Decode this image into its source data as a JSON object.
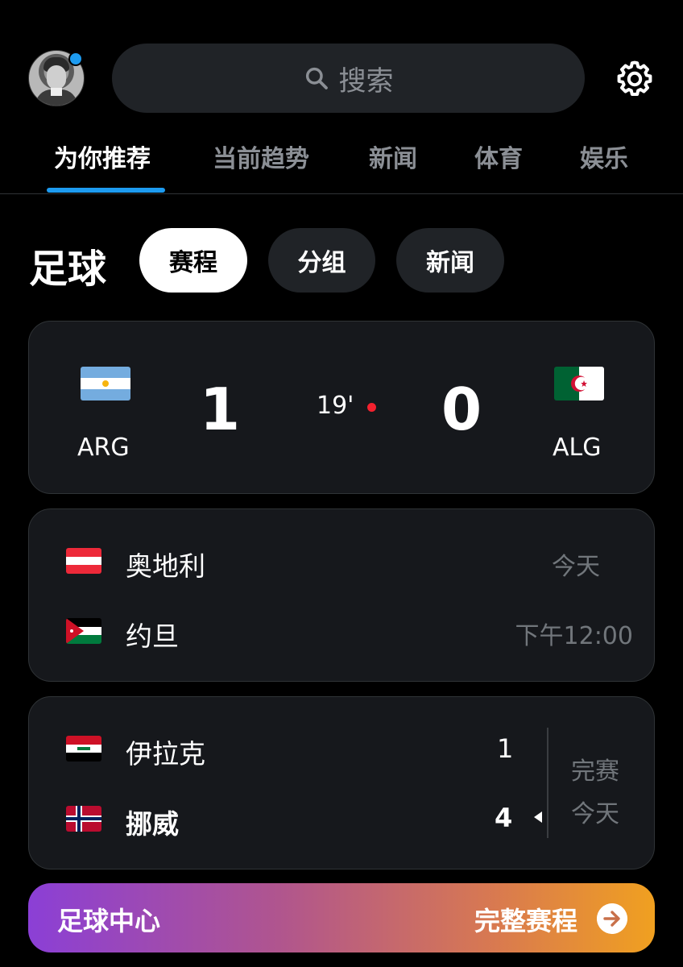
{
  "header": {
    "search_placeholder": "搜索",
    "avatar_icon": "user-avatar",
    "settings_icon": "gear-icon",
    "notification_dot_color": "#1d9bf0"
  },
  "tabs": [
    {
      "label": "为你推荐",
      "active": true
    },
    {
      "label": "当前趋势",
      "active": false
    },
    {
      "label": "新闻",
      "active": false
    },
    {
      "label": "体育",
      "active": false
    },
    {
      "label": "娱乐",
      "active": false
    }
  ],
  "section": {
    "title": "足球",
    "pills": [
      {
        "label": "赛程",
        "active": true
      },
      {
        "label": "分组",
        "active": false
      },
      {
        "label": "新闻",
        "active": false
      }
    ]
  },
  "live_match": {
    "home": {
      "code": "ARG",
      "flag": "argentina-flag",
      "score": "1"
    },
    "away": {
      "code": "ALG",
      "flag": "algeria-flag",
      "score": "0"
    },
    "minute": "19'",
    "live_color": "#f4212e"
  },
  "upcoming_match": {
    "team1": {
      "name": "奥地利",
      "flag": "austria-flag"
    },
    "team2": {
      "name": "约旦",
      "flag": "jordan-flag"
    },
    "day": "今天",
    "time": "下午12:00"
  },
  "finished_match": {
    "team1": {
      "name": "伊拉克",
      "flag": "iraq-flag",
      "score": "1"
    },
    "team2": {
      "name": "挪威",
      "flag": "norway-flag",
      "score": "4",
      "winner": true
    },
    "status": "完赛",
    "day": "今天"
  },
  "banner": {
    "left_label": "足球中心",
    "right_label": "完整赛程",
    "arrow_icon": "arrow-right-circle-icon"
  }
}
